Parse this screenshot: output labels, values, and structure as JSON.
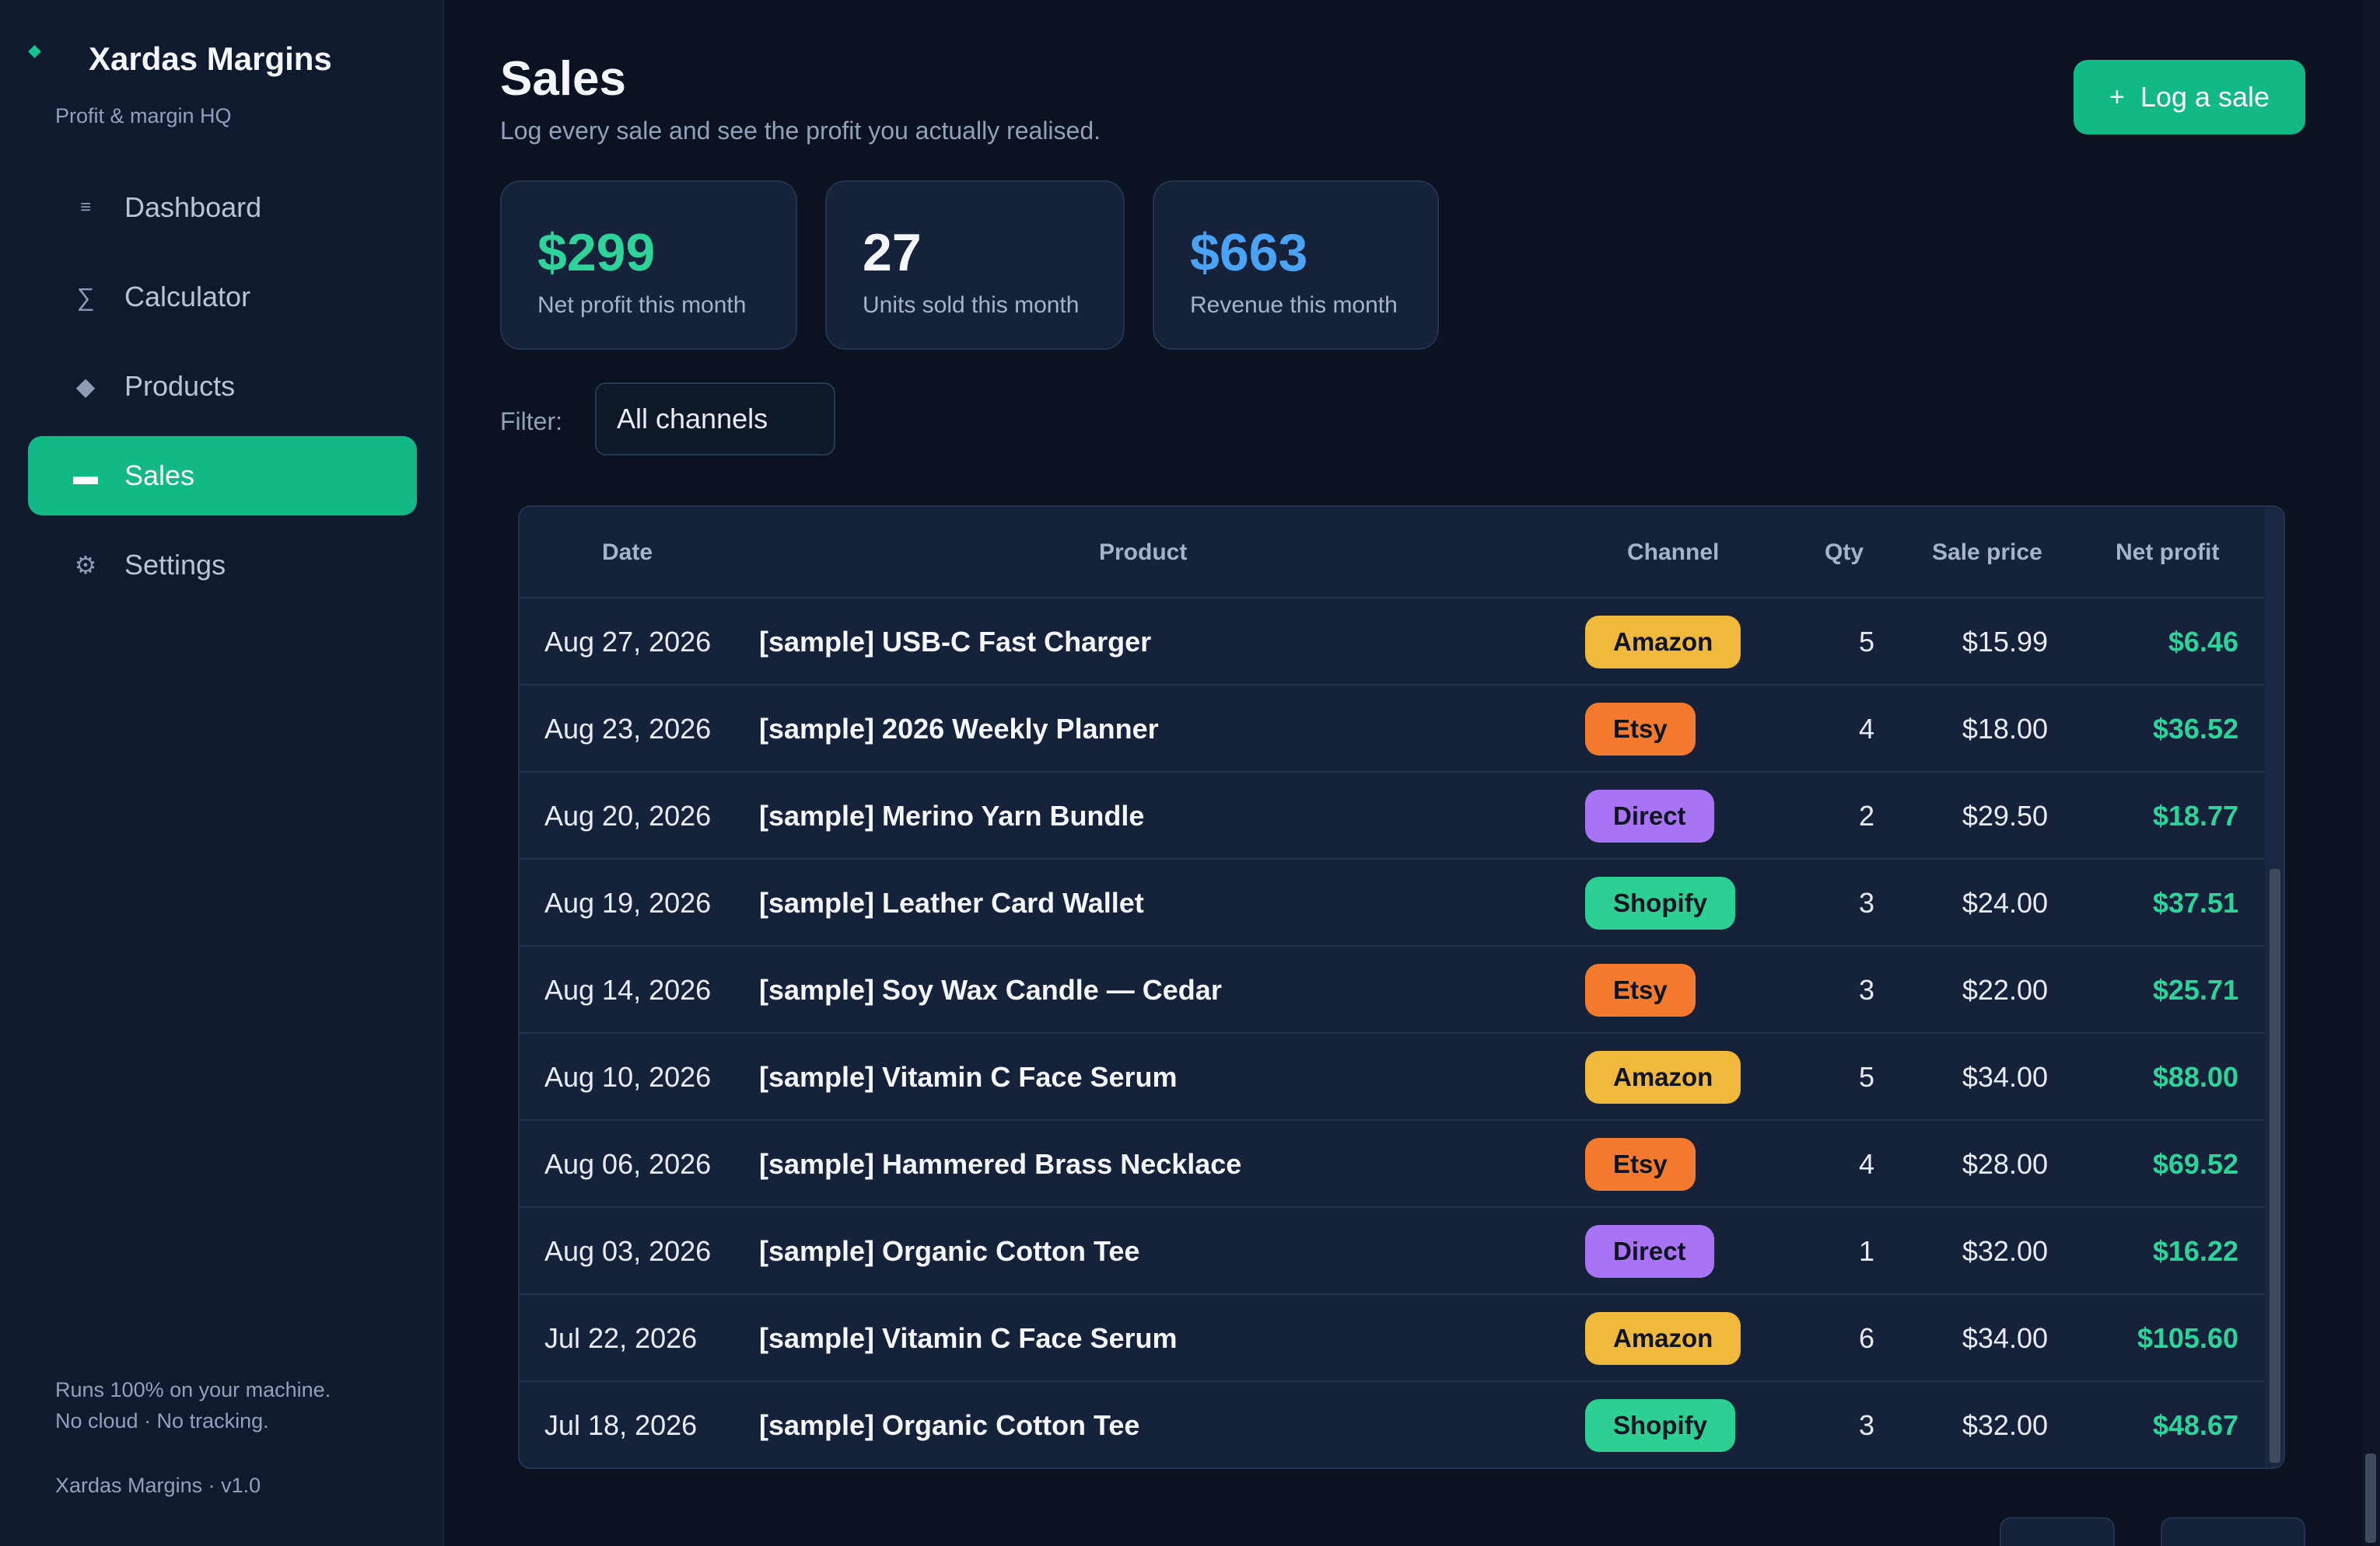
{
  "sidebar": {
    "brand_name": "Xardas Margins",
    "brand_sub": "Profit & margin HQ",
    "items": [
      {
        "label": "Dashboard",
        "icon": "dashboard-icon",
        "glyph": "≡"
      },
      {
        "label": "Calculator",
        "icon": "sigma-icon",
        "glyph": "∑"
      },
      {
        "label": "Products",
        "icon": "diamond-icon",
        "glyph": "◆"
      },
      {
        "label": "Sales",
        "icon": "sales-icon",
        "glyph": "▬"
      },
      {
        "label": "Settings",
        "icon": "gear-icon",
        "glyph": "⚙"
      }
    ],
    "footer_line1": "Runs 100% on your machine.",
    "footer_line2": "No cloud · No tracking.",
    "version": "Xardas Margins · v1.0"
  },
  "header": {
    "title": "Sales",
    "subtitle": "Log every sale and see the profit you actually realised.",
    "log_button": "Log a sale",
    "log_button_glyph": "+"
  },
  "stats": [
    {
      "value": "$299",
      "caption": "Net profit this month",
      "color": "#2ed39a"
    },
    {
      "value": "27",
      "caption": "Units sold this month",
      "color": "#f4f7fb"
    },
    {
      "value": "$663",
      "caption": "Revenue this month",
      "color": "#4aa3f5"
    }
  ],
  "filter": {
    "label": "Filter:",
    "value": "All channels"
  },
  "table": {
    "columns": [
      "Date",
      "Product",
      "Channel",
      "Qty",
      "Sale price",
      "Net profit"
    ],
    "rows": [
      {
        "date": "Aug 27, 2026",
        "product": "[sample] USB-C Fast Charger",
        "channel": "Amazon",
        "qty": "5",
        "price": "$15.99",
        "profit": "$6.46"
      },
      {
        "date": "Aug 23, 2026",
        "product": "[sample] 2026 Weekly Planner",
        "channel": "Etsy",
        "qty": "4",
        "price": "$18.00",
        "profit": "$36.52"
      },
      {
        "date": "Aug 20, 2026",
        "product": "[sample] Merino Yarn Bundle",
        "channel": "Direct",
        "qty": "2",
        "price": "$29.50",
        "profit": "$18.77"
      },
      {
        "date": "Aug 19, 2026",
        "product": "[sample] Leather Card Wallet",
        "channel": "Shopify",
        "qty": "3",
        "price": "$24.00",
        "profit": "$37.51"
      },
      {
        "date": "Aug 14, 2026",
        "product": "[sample] Soy Wax Candle — Cedar",
        "channel": "Etsy",
        "qty": "3",
        "price": "$22.00",
        "profit": "$25.71"
      },
      {
        "date": "Aug 10, 2026",
        "product": "[sample] Vitamin C Face Serum",
        "channel": "Amazon",
        "qty": "5",
        "price": "$34.00",
        "profit": "$88.00"
      },
      {
        "date": "Aug 06, 2026",
        "product": "[sample] Hammered Brass Necklace",
        "channel": "Etsy",
        "qty": "4",
        "price": "$28.00",
        "profit": "$69.52"
      },
      {
        "date": "Aug 03, 2026",
        "product": "[sample] Organic Cotton Tee",
        "channel": "Direct",
        "qty": "1",
        "price": "$32.00",
        "profit": "$16.22"
      },
      {
        "date": "Jul 22, 2026",
        "product": "[sample] Vitamin C Face Serum",
        "channel": "Amazon",
        "qty": "6",
        "price": "$34.00",
        "profit": "$105.60"
      },
      {
        "date": "Jul 18, 2026",
        "product": "[sample] Organic Cotton Tee",
        "channel": "Shopify",
        "qty": "3",
        "price": "$32.00",
        "profit": "$48.67"
      }
    ]
  },
  "channel_colors": {
    "Amazon": "#f0b93b",
    "Etsy": "#f47a2e",
    "Direct": "#a874f5",
    "Shopify": "#2ecf92"
  },
  "colors": {
    "accent": "#12b886",
    "profit": "#2ed39a",
    "revenue": "#4aa3f5"
  }
}
